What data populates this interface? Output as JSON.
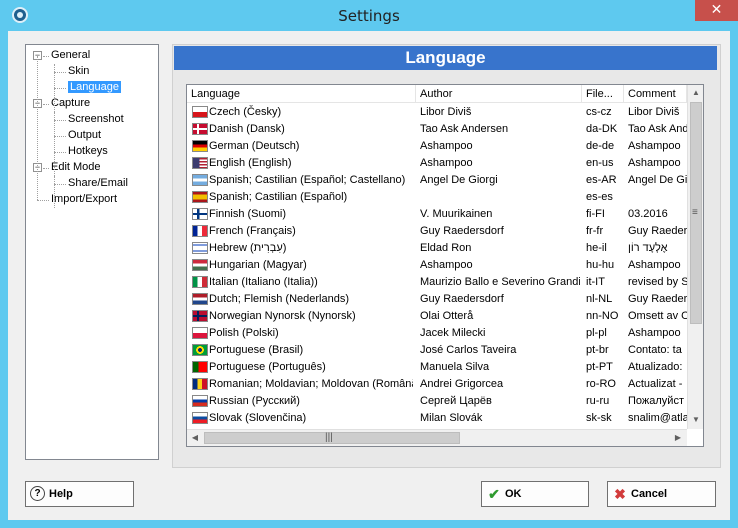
{
  "window": {
    "title": "Settings",
    "close_glyph": "✕"
  },
  "tree": {
    "items": [
      {
        "label": "General",
        "level": 0,
        "expander": "−"
      },
      {
        "label": "Skin",
        "level": 1
      },
      {
        "label": "Language",
        "level": 1,
        "selected": true
      },
      {
        "label": "Capture",
        "level": 0,
        "expander": "−"
      },
      {
        "label": "Screenshot",
        "level": 1
      },
      {
        "label": "Output",
        "level": 1
      },
      {
        "label": "Hotkeys",
        "level": 1
      },
      {
        "label": "Edit Mode",
        "level": 0,
        "expander": "−"
      },
      {
        "label": "Share/Email",
        "level": 1
      },
      {
        "label": "Import/Export",
        "level": 0
      }
    ]
  },
  "panel": {
    "title": "Language"
  },
  "table": {
    "columns": [
      "Language",
      "Author",
      "File...",
      "Comment"
    ],
    "rows": [
      {
        "flag": "cz",
        "language": "Czech (Česky)",
        "author": "Libor Diviš",
        "file": "cs-cz",
        "comment": "Libor Diviš"
      },
      {
        "flag": "dk",
        "language": "Danish (Dansk)",
        "author": "Tao Ask Andersen",
        "file": "da-DK",
        "comment": "Tao Ask Andersen"
      },
      {
        "flag": "de",
        "language": "German (Deutsch)",
        "author": "Ashampoo",
        "file": "de-de",
        "comment": "Ashampoo"
      },
      {
        "flag": "us",
        "language": "English (English)",
        "author": "Ashampoo",
        "file": "en-us",
        "comment": "Ashampoo"
      },
      {
        "flag": "ar",
        "language": "Spanish; Castilian (Español; Castellano)",
        "author": "Angel De Giorgi",
        "file": "es-AR",
        "comment": "Angel De Giorgi"
      },
      {
        "flag": "es",
        "language": "Spanish; Castilian (Español)",
        "author": "",
        "file": "es-es",
        "comment": ""
      },
      {
        "flag": "fi",
        "language": "Finnish (Suomi)",
        "author": "V. Muurikainen",
        "file": "fi-FI",
        "comment": "03.2016"
      },
      {
        "flag": "fr",
        "language": "French (Français)",
        "author": "Guy Raedersdorf",
        "file": "fr-fr",
        "comment": "Guy Raedersdorf"
      },
      {
        "flag": "il",
        "language": "Hebrew (עִבְרִית)",
        "author": "Eldad Ron",
        "file": "he-il",
        "comment": "אֶלְעָד רוֹן"
      },
      {
        "flag": "hu",
        "language": "Hungarian (Magyar)",
        "author": "Ashampoo",
        "file": "hu-hu",
        "comment": "Ashampoo"
      },
      {
        "flag": "it",
        "language": "Italian (Italiano (Italia))",
        "author": "Maurizio Ballo e Severino Grandi",
        "file": "it-IT",
        "comment": "revised by S"
      },
      {
        "flag": "nl",
        "language": "Dutch; Flemish (Nederlands)",
        "author": "Guy Raedersdorf",
        "file": "nl-NL",
        "comment": "Guy Raedersdorf"
      },
      {
        "flag": "no",
        "language": "Norwegian Nynorsk (Nynorsk)",
        "author": "Olai Otterå",
        "file": "nn-NO",
        "comment": "Omsett av O"
      },
      {
        "flag": "pl",
        "language": "Polish (Polski)",
        "author": "Jacek Milecki",
        "file": "pl-pl",
        "comment": "Ashampoo"
      },
      {
        "flag": "br",
        "language": "Portuguese (Brasil)",
        "author": "José Carlos Taveira",
        "file": "pt-br",
        "comment": "Contato: ta"
      },
      {
        "flag": "pt",
        "language": "Portuguese (Português)",
        "author": "Manuela Silva",
        "file": "pt-PT",
        "comment": "Atualizado:"
      },
      {
        "flag": "ro",
        "language": "Romanian; Moldavian; Moldovan (Română)",
        "author": "Andrei Grigorcea",
        "file": "ro-RO",
        "comment": "Actualizat -"
      },
      {
        "flag": "ru",
        "language": "Russian (Русский)",
        "author": "Сергей Царёв",
        "file": "ru-ru",
        "comment": "Пожалуйст"
      },
      {
        "flag": "sk",
        "language": "Slovak (Slovenčina)",
        "author": "Milan Slovák",
        "file": "sk-sk",
        "comment": "snalim@atla"
      }
    ]
  },
  "buttons": {
    "help": {
      "label": "Help",
      "icon": "help-icon"
    },
    "ok": {
      "label": "OK",
      "icon": "checkmark-icon"
    },
    "cancel": {
      "label": "Cancel",
      "icon": "cancel-x-icon"
    }
  }
}
